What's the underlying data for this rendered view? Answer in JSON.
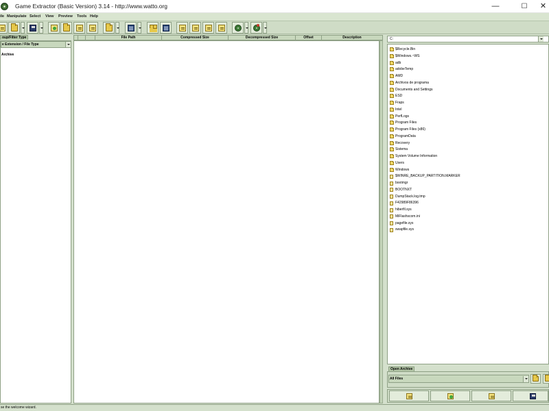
{
  "window": {
    "title": "Game Extractor (Basic Version) 3.14 - http://www.watto.org",
    "minimize": "—",
    "maximize": "☐",
    "close": "✕"
  },
  "menu": [
    "ile",
    "Manipulate",
    "Select",
    "View",
    "Preview",
    "Tools",
    "Help"
  ],
  "left_panel": {
    "tab": "oup/Filter Type",
    "combo": "e Extension / File Type",
    "tree_root": "Archive"
  },
  "table": {
    "columns": [
      "File Path",
      "Compressed Size",
      "Decompressed Size",
      "Offset",
      "Description"
    ]
  },
  "explorer": {
    "path": "C:",
    "items": [
      {
        "name": "$Recycle.Bin",
        "type": "folder"
      },
      {
        "name": "$Windows.~WS",
        "type": "folder"
      },
      {
        "name": "adb",
        "type": "folder"
      },
      {
        "name": "adobeTemp",
        "type": "folder"
      },
      {
        "name": "AMD",
        "type": "folder"
      },
      {
        "name": "Archivos de programa",
        "type": "folder"
      },
      {
        "name": "Documents and Settings",
        "type": "folder"
      },
      {
        "name": "ESD",
        "type": "folder"
      },
      {
        "name": "Fraps",
        "type": "folder"
      },
      {
        "name": "Intel",
        "type": "folder"
      },
      {
        "name": "PerfLogs",
        "type": "folder"
      },
      {
        "name": "Program Files",
        "type": "folder"
      },
      {
        "name": "Program Files (x86)",
        "type": "folder"
      },
      {
        "name": "ProgramData",
        "type": "folder"
      },
      {
        "name": "Recovery",
        "type": "folder"
      },
      {
        "name": "Sistema",
        "type": "folder"
      },
      {
        "name": "System Volume Information",
        "type": "folder"
      },
      {
        "name": "Users",
        "type": "folder"
      },
      {
        "name": "Windows",
        "type": "folder"
      },
      {
        "name": "$WINRE_BACKUP_PARTITION.MARKER",
        "type": "file"
      },
      {
        "name": "bootmgr",
        "type": "file"
      },
      {
        "name": "BOOTNXT",
        "type": "file"
      },
      {
        "name": "DumpStack.log.tmp",
        "type": "file"
      },
      {
        "name": "F42989F86396",
        "type": "file"
      },
      {
        "name": "hiberfil.sys",
        "type": "file"
      },
      {
        "name": "MiFlashscom.ini",
        "type": "file"
      },
      {
        "name": "pagefile.sys",
        "type": "file"
      },
      {
        "name": "swapfile.sys",
        "type": "file"
      }
    ]
  },
  "open_archive": {
    "tab": "Open Archive",
    "filter": "All Files"
  },
  "status": "se the welcome wizard."
}
